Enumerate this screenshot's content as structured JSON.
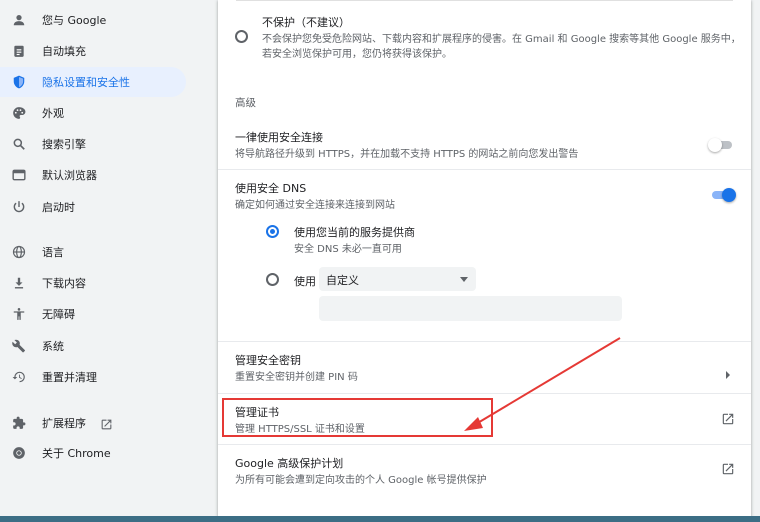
{
  "sidebar": {
    "items": [
      {
        "label": "您与 Google",
        "icon": "person-icon"
      },
      {
        "label": "自动填充",
        "icon": "clipboard-icon"
      },
      {
        "label": "隐私设置和安全性",
        "icon": "shield-icon",
        "active": true
      },
      {
        "label": "外观",
        "icon": "palette-icon"
      },
      {
        "label": "搜索引擎",
        "icon": "search-icon"
      },
      {
        "label": "默认浏览器",
        "icon": "browser-window-icon"
      },
      {
        "label": "启动时",
        "icon": "power-icon"
      },
      {
        "label": "语言",
        "icon": "globe-icon"
      },
      {
        "label": "下载内容",
        "icon": "download-icon"
      },
      {
        "label": "无障碍",
        "icon": "accessibility-icon"
      },
      {
        "label": "系统",
        "icon": "wrench-icon"
      },
      {
        "label": "重置并清理",
        "icon": "restore-icon"
      },
      {
        "label": "扩展程序",
        "icon": "puzzle-icon"
      },
      {
        "label": "关于 Chrome",
        "icon": "chrome-icon"
      }
    ]
  },
  "main": {
    "no_protection": {
      "title": "不保护（不建议）",
      "desc_line1": "不会保护您免受危险网站、下载内容和扩展程序的侵害。在 Gmail 和 Google 搜索等其他 Google 服务中，",
      "desc_line2": "若安全浏览保护可用，您仍将获得该保护。"
    },
    "advanced_heading": "高级",
    "https": {
      "title": "一律使用安全连接",
      "desc": "将导航路径升级到 HTTPS，并在加载不支持 HTTPS 的网站之前向您发出警告",
      "enabled": false
    },
    "secure_dns": {
      "title": "使用安全 DNS",
      "desc": "确定如何通过安全连接来连接到网站",
      "enabled": true,
      "option_current_title": "使用您当前的服务提供商",
      "option_current_desc": "安全 DNS 未必一直可用",
      "option_custom_label": "使用",
      "select_value": "自定义",
      "custom_input_value": ""
    },
    "security_keys": {
      "title": "管理安全密钥",
      "desc": "重置安全密钥并创建 PIN 码"
    },
    "certificates": {
      "title": "管理证书",
      "desc": "管理 HTTPS/SSL 证书和设置"
    },
    "advanced_protection": {
      "title": "Google 高级保护计划",
      "desc": "为所有可能会遭到定向攻击的个人 Google 帐号提供保护"
    }
  },
  "colors": {
    "accent": "#1a73e8",
    "annotation_red": "#e53935",
    "background": "#f1f3f4"
  }
}
